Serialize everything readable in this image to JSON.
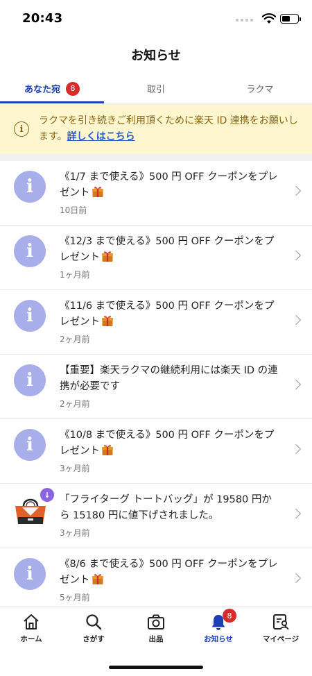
{
  "status_bar": {
    "time": "20:43"
  },
  "header": {
    "title": "お知らせ"
  },
  "tabs": [
    {
      "label": "あなた宛",
      "badge": "8",
      "active": true
    },
    {
      "label": "取引",
      "active": false
    },
    {
      "label": "ラクマ",
      "active": false
    }
  ],
  "banner": {
    "icon": "info-icon",
    "text": "ラクマを引き続きご利用頂くために楽天 ID 連携をお願いします。",
    "link": "詳しくはこちら"
  },
  "notifications": [
    {
      "icon": "info-icon",
      "text": "《1/7 まで使える》500 円 OFF クーポンをプレゼント",
      "gift": true,
      "time": "10日前"
    },
    {
      "icon": "info-icon",
      "text": "《12/3 まで使える》500 円 OFF クーポンをプレゼント",
      "gift": true,
      "time": "1ヶ月前"
    },
    {
      "icon": "info-icon",
      "text": "《11/6 まで使える》500 円 OFF クーポンをプレゼント",
      "gift": true,
      "time": "2ヶ月前"
    },
    {
      "icon": "info-icon",
      "text": "【重要】楽天ラクマの継続利用には楽天 ID の連携が必要です",
      "gift": false,
      "time": "2ヶ月前"
    },
    {
      "icon": "info-icon",
      "text": "《10/8 まで使える》500 円 OFF クーポンをプレゼント",
      "gift": true,
      "time": "3ヶ月前"
    },
    {
      "icon": "tote-bag-thumbnail",
      "text": "「フライターグ トートバッグ」が 19580 円から 15180 円に値下げされました。",
      "gift": false,
      "time": "3ヶ月前"
    },
    {
      "icon": "info-icon",
      "text": "《8/6 まで使える》500 円 OFF クーポンをプレゼント",
      "gift": true,
      "time": "5ヶ月前"
    }
  ],
  "bottom_nav": [
    {
      "label": "ホーム",
      "icon": "home-icon"
    },
    {
      "label": "さがす",
      "icon": "search-icon"
    },
    {
      "label": "出品",
      "icon": "camera-icon"
    },
    {
      "label": "お知らせ",
      "icon": "bell-icon",
      "badge": "8",
      "active": true
    },
    {
      "label": "マイページ",
      "icon": "profile-icon"
    }
  ],
  "colors": {
    "accent": "#1d3fb5",
    "badge": "#d62c2c",
    "banner_bg": "#fdf6cf",
    "banner_text": "#8a6212",
    "avatar": "#a7aeea"
  }
}
